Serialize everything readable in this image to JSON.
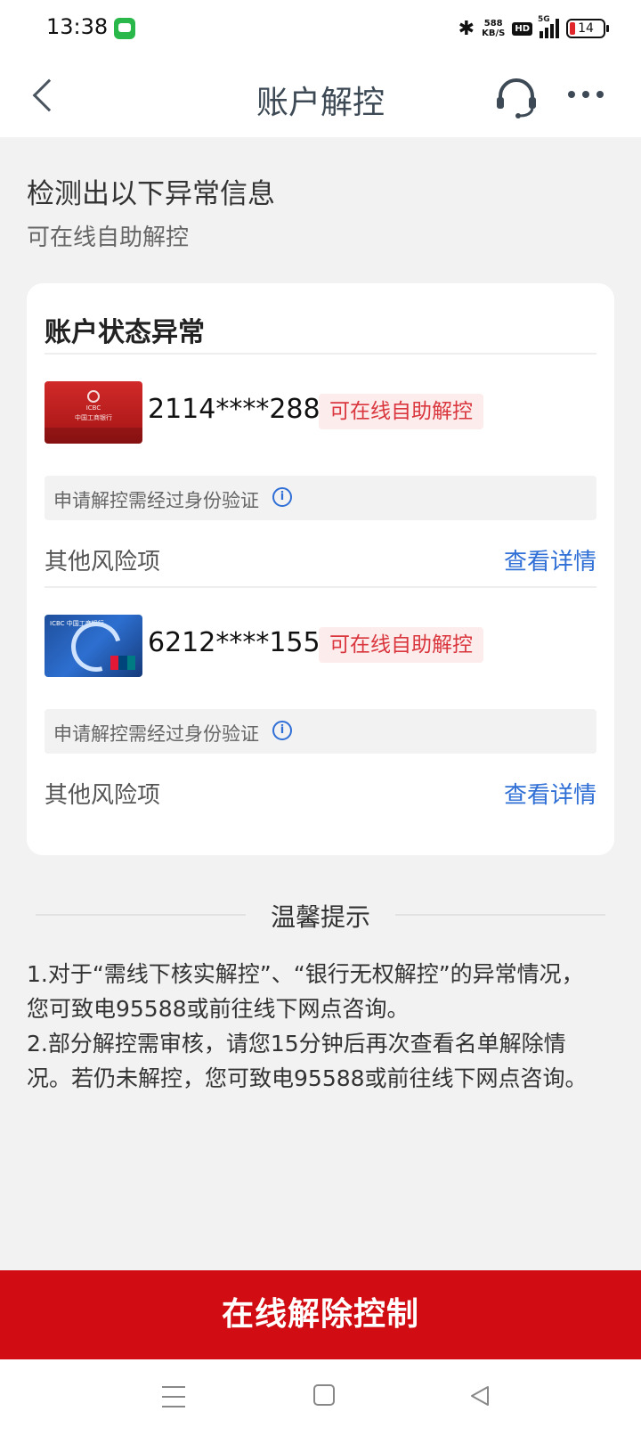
{
  "status_bar": {
    "time": "13:38",
    "net_speed_value": "588",
    "net_speed_unit": "KB/S",
    "hd": "HD",
    "network": "5G",
    "battery": "14"
  },
  "nav": {
    "title": "账户解控"
  },
  "intro": {
    "title": "检测出以下异常信息",
    "subtitle": "可在线自助解控"
  },
  "card": {
    "title": "账户状态异常",
    "accounts": [
      {
        "number": "2114****2884",
        "status": "可在线自助解控",
        "notice": "申请解控需经过身份验证",
        "risk_label": "其他风险项",
        "details_label": "查看详情"
      },
      {
        "number": "6212****1554",
        "status": "可在线自助解控",
        "notice": "申请解控需经过身份验证",
        "risk_label": "其他风险项",
        "details_label": "查看详情"
      }
    ]
  },
  "tips": {
    "title": "温馨提示",
    "lines": [
      "1.对于“需线下核实解控”、“银行无权解控”的异常情况，您可致电95588或前往线下网点咨询。",
      "2.部分解控需审核，请您15分钟后再次查看名单解除情况。若仍未解控，您可致电95588或前往线下网点咨询。"
    ]
  },
  "primary_button": {
    "label": "在线解除控制"
  },
  "colors": {
    "brand_red": "#d20c13",
    "link_blue": "#2f6fd6",
    "tag_red": "#d9363e"
  }
}
